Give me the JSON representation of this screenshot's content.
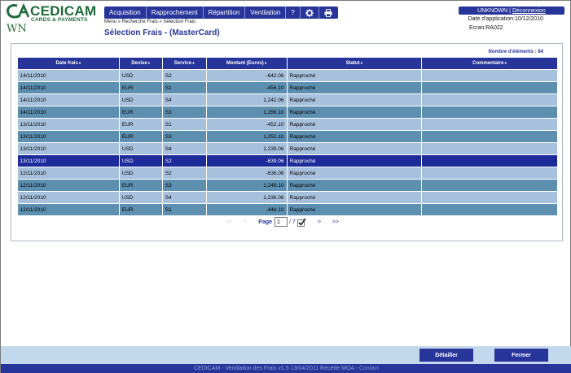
{
  "brand": {
    "name": "CEDICAM",
    "subtitle": "CARDS & PAYMENTS",
    "color": "#1f6a3a"
  },
  "wn_label": "WN",
  "nav": {
    "items": [
      "Acquisition",
      "Rapprochement",
      "Répartition",
      "Ventilation",
      "?"
    ],
    "icons": [
      "gear-icon",
      "print-icon"
    ]
  },
  "breadcrumb": "Menu » Recherche Frais » Sélection Frais",
  "page_title": "Sélection Frais - (MasterCard)",
  "user": {
    "name": "UNKNOWN",
    "separator": "|",
    "logout": "Déconnexion"
  },
  "app_date": "Date d'application:10/12/2010",
  "screen_code": "Ecran:RA022",
  "count_label": "Nombre d'éléments : 84",
  "table": {
    "headers": [
      "Date frais",
      "Devise",
      "Service",
      "Montant (Euros)",
      "Statut",
      "Commentaire"
    ],
    "sort_glyph": "♦",
    "rows": [
      {
        "date": "14/11/2010",
        "devise": "USD",
        "service": "S2",
        "montant": "-642.06",
        "statut": "Rapproché",
        "commentaire": ""
      },
      {
        "date": "14/11/2010",
        "devise": "EUR",
        "service": "S1",
        "montant": "-456.10",
        "statut": "Rapproché",
        "commentaire": ""
      },
      {
        "date": "14/11/2010",
        "devise": "USD",
        "service": "S4",
        "montant": "1,242.06",
        "statut": "Rapproché",
        "commentaire": ""
      },
      {
        "date": "14/11/2010",
        "devise": "EUR",
        "service": "S3",
        "montant": "1,256.10",
        "statut": "Rapproché",
        "commentaire": ""
      },
      {
        "date": "13/11/2010",
        "devise": "EUR",
        "service": "S1",
        "montant": "-452.10",
        "statut": "Rapproché",
        "commentaire": ""
      },
      {
        "date": "13/11/2010",
        "devise": "EUR",
        "service": "S3",
        "montant": "1,252.10",
        "statut": "Rapproché",
        "commentaire": ""
      },
      {
        "date": "13/11/2010",
        "devise": "USD",
        "service": "S4",
        "montant": "1,239.06",
        "statut": "Rapproché",
        "commentaire": ""
      },
      {
        "date": "13/11/2010",
        "devise": "USD",
        "service": "S2",
        "montant": "-639.06",
        "statut": "Rapproché",
        "commentaire": "",
        "selected": true
      },
      {
        "date": "12/11/2010",
        "devise": "USD",
        "service": "S2",
        "montant": "-636.06",
        "statut": "Rapproché",
        "commentaire": ""
      },
      {
        "date": "12/11/2010",
        "devise": "EUR",
        "service": "S3",
        "montant": "1,248.10",
        "statut": "Rapproché",
        "commentaire": ""
      },
      {
        "date": "12/11/2010",
        "devise": "USD",
        "service": "S4",
        "montant": "1,236.06",
        "statut": "Rapproché",
        "commentaire": ""
      },
      {
        "date": "12/11/2010",
        "devise": "EUR",
        "service": "S1",
        "montant": "-448.10",
        "statut": "Rapproché",
        "commentaire": ""
      }
    ]
  },
  "pager": {
    "first": "<<",
    "prev": "<",
    "next": ">",
    "last": ">>",
    "label": "Page",
    "current": "1",
    "total": "/ 7"
  },
  "buttons": {
    "details": "Détailler",
    "close": "Fermer"
  },
  "status": {
    "text": "CEDICAM - Ventilation des Frais v1.5 13/04/2011 Recette MOA -",
    "link": "Contact"
  },
  "colors": {
    "primary": "#27359a",
    "row_light": "#a7c1dd",
    "row_dark": "#5d8fb0",
    "row_selected": "#1d2c9a",
    "footer_band": "#c2d8ec"
  }
}
